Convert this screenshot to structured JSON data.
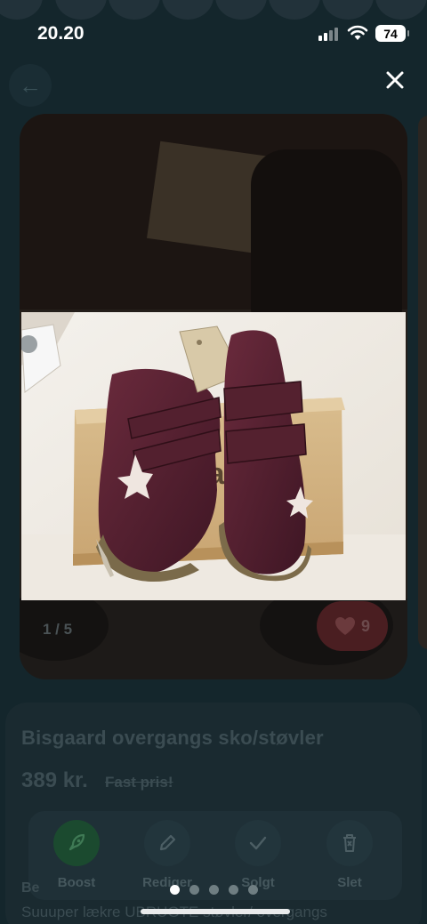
{
  "status_bar": {
    "time": "20.20",
    "battery": "74"
  },
  "photo_viewer": {
    "counter": "1 / 5",
    "page_count": 5,
    "active_page": 1
  },
  "listing": {
    "title": "Bisgaard overgangs sko/støvler",
    "price": "389 kr.",
    "price_note": "Fast pris!",
    "likes": "9",
    "description_heading": "Be",
    "description": "Suuuper lækre UBRUGTE støvler/ overgangs"
  },
  "actions": [
    {
      "label": "Boost",
      "icon": "rocket-icon"
    },
    {
      "label": "Rediger",
      "icon": "pencil-icon"
    },
    {
      "label": "Solgt",
      "icon": "checkmark-icon"
    },
    {
      "label": "Slet",
      "icon": "trash-icon"
    }
  ],
  "photo_caption": {
    "box_brand": "sgaa"
  },
  "colors": {
    "accent_green": "#1b4a2f",
    "like_red": "#4a1e21",
    "overlay": "#0b1c22"
  }
}
